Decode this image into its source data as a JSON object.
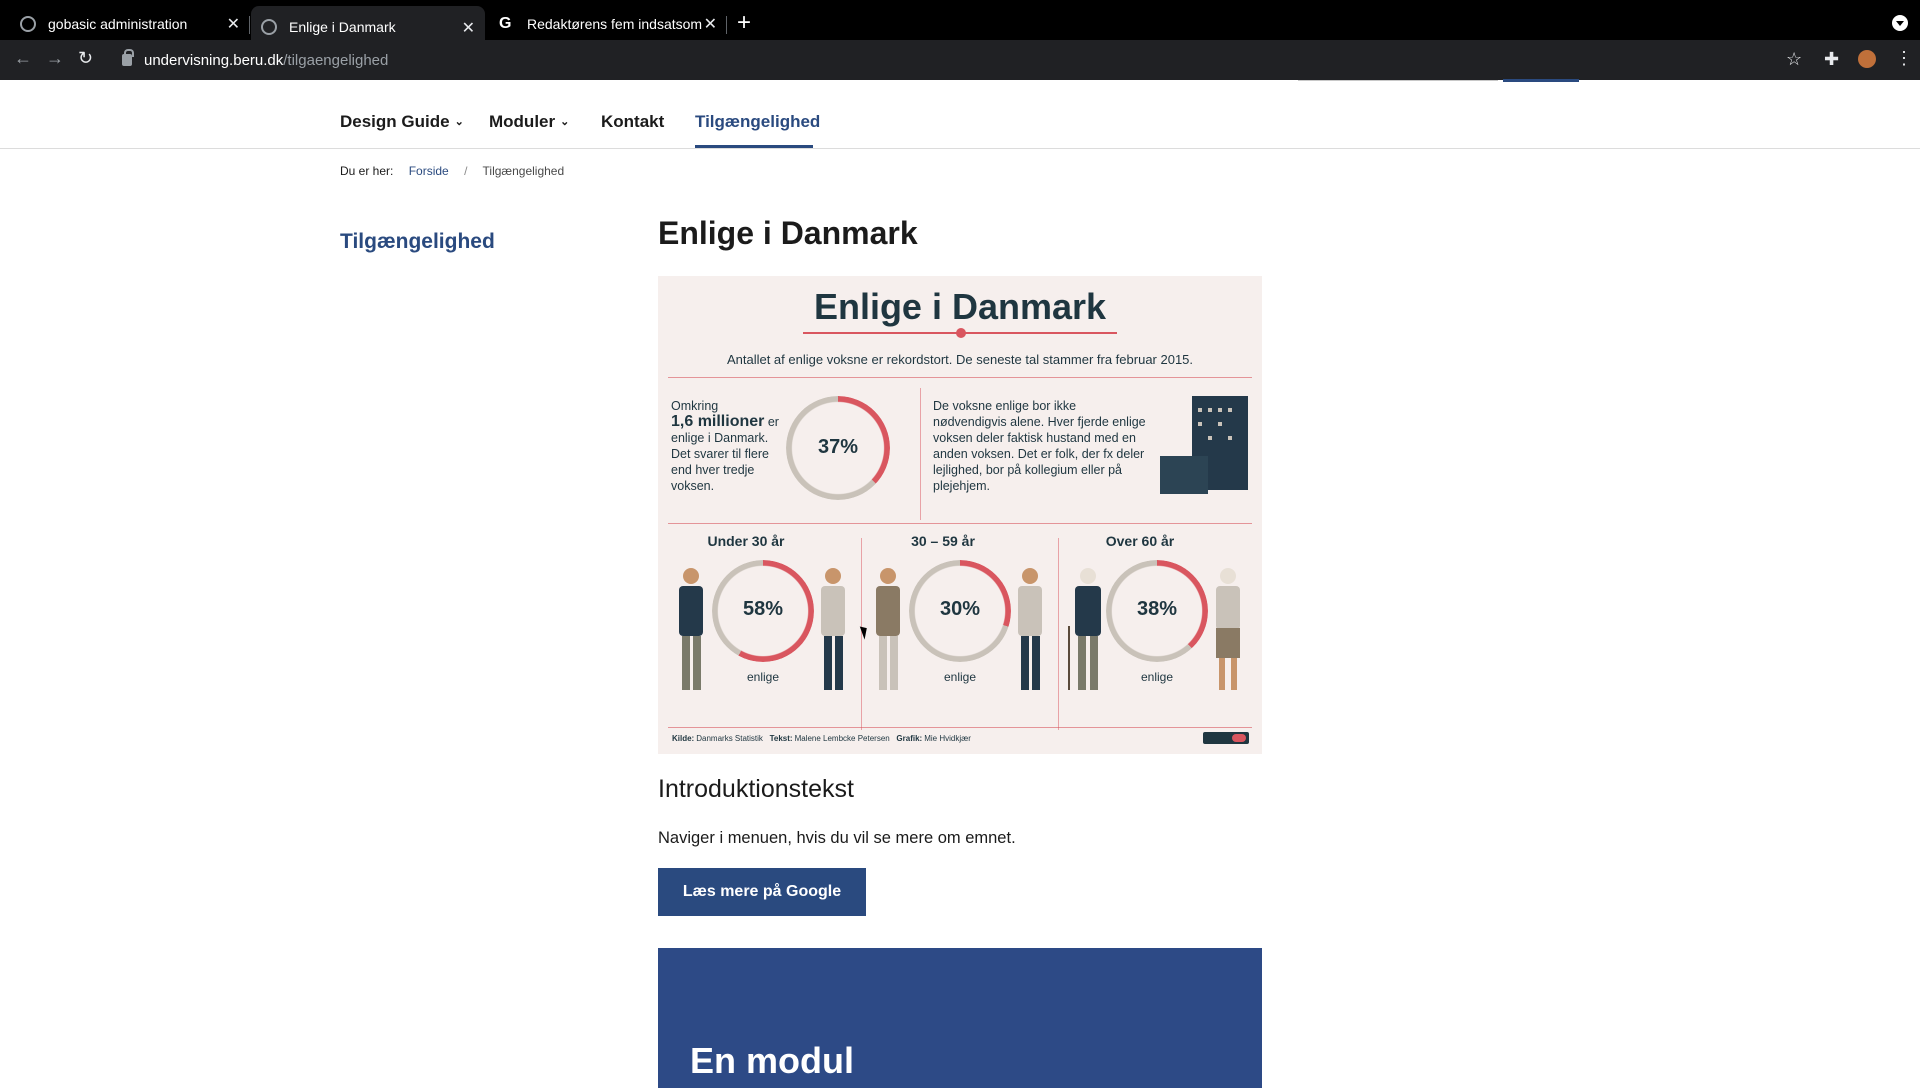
{
  "browser": {
    "tabs": [
      {
        "title": "gobasic administration"
      },
      {
        "title": "Enlige i Danmark"
      },
      {
        "title": "Redaktørens fem indsatsområ"
      }
    ],
    "url_host": "undervisning.beru.dk",
    "url_path": "/tilgaengelighed",
    "icons": [
      "globe-icon",
      "close-icon",
      "google-icon",
      "plus-icon",
      "back-icon",
      "forward-icon",
      "reload-icon",
      "lock-icon",
      "star-icon",
      "puzzle-icon",
      "avatar",
      "kebab-icon",
      "profile-menu-icon"
    ]
  },
  "site_nav": {
    "items": [
      {
        "label": "Design Guide",
        "has_dropdown": true
      },
      {
        "label": "Moduler",
        "has_dropdown": true
      },
      {
        "label": "Kontakt",
        "has_dropdown": false
      },
      {
        "label": "Tilgængelighed",
        "has_dropdown": false,
        "active": true
      }
    ]
  },
  "breadcrumb": {
    "prefix": "Du er her:",
    "home": "Forside",
    "separator": "/",
    "current": "Tilgængelighed"
  },
  "sidebar": {
    "title": "Tilgængelighed"
  },
  "main": {
    "title": "Enlige i Danmark",
    "infographic": {
      "title": "Enlige i Danmark",
      "subtitle": "Antallet af enlige voksne er rekordstort. De seneste tal stammer fra februar 2015.",
      "left_intro": "Omkring",
      "left_big": "1,6 millioner",
      "left_rest": "er enlige i Danmark. Det svarer til flere end hver tredje voksen.",
      "overall_percent": "37%",
      "overall_value": 37,
      "right_text": "De voksne enlige bor ikke nødvendigvis alene. Hver fjerde enlige voksen deler faktisk hustand med en anden voksen. Det er folk, der fx deler lejlighed, bor på kollegium eller på plejehjem.",
      "groups": [
        {
          "title": "Under 30 år",
          "percent": "58%",
          "value": 58,
          "label": "enlige"
        },
        {
          "title": "30 – 59 år",
          "percent": "30%",
          "value": 30,
          "label": "enlige"
        },
        {
          "title": "Over 60 år",
          "percent": "38%",
          "value": 38,
          "label": "enlige"
        }
      ],
      "footer": {
        "source_label": "Kilde:",
        "source": "Danmarks Statistik",
        "text_label": "Tekst:",
        "text": "Malene Lembcke Petersen",
        "graphic_label": "Grafik:",
        "graphic": "Mie Hvidkjær"
      },
      "colors": {
        "accent": "#d9565f",
        "ring": "#c9c2b9",
        "ink": "#1f3640",
        "bg": "#f6efed"
      }
    },
    "intro_heading": "Introduktionstekst",
    "intro_text": "Naviger i menuen, hvis du vil se mere om emnet.",
    "cta_label": "Læs mere på Google",
    "module_title": "En modul"
  },
  "colors": {
    "brand": "#2a4a7f",
    "module_bg": "#2d4a86"
  }
}
